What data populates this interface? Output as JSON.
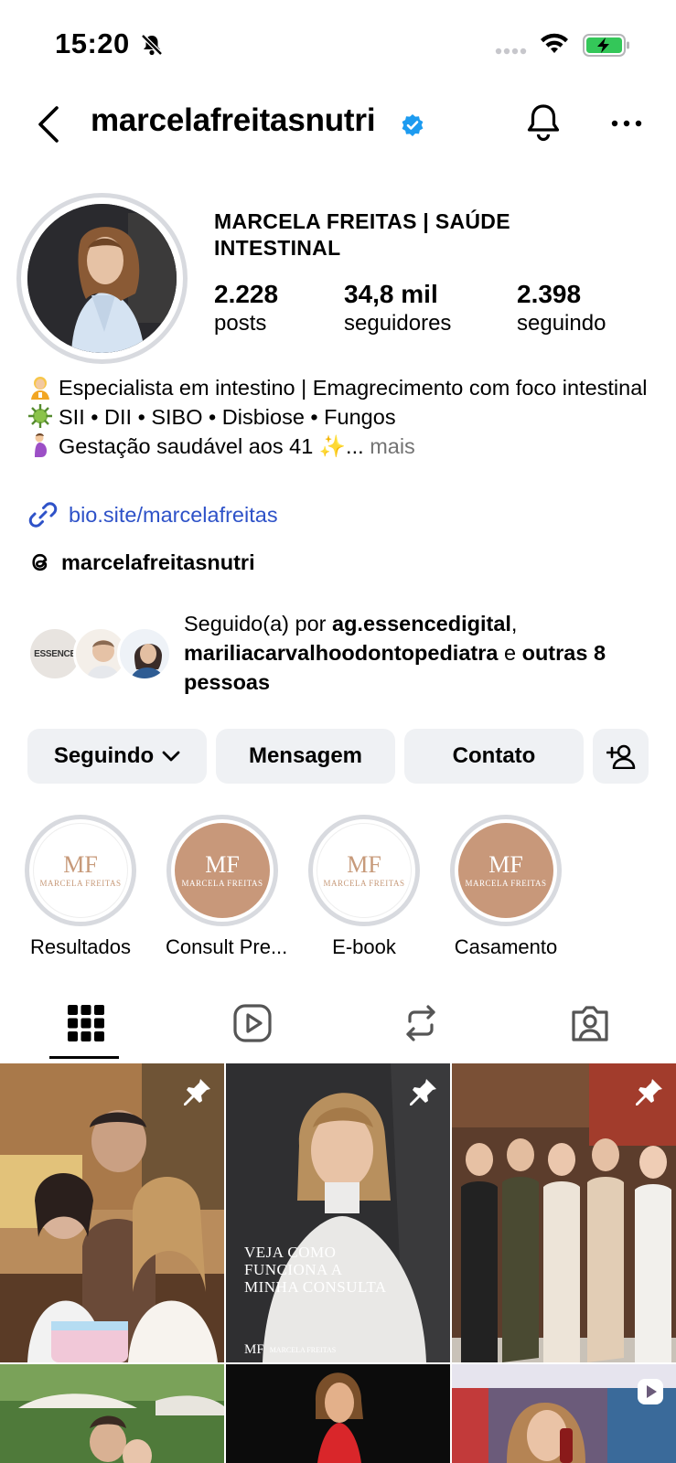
{
  "status_bar": {
    "time": "15:20",
    "icons": [
      "bell-slash-icon",
      "signal-icon",
      "wifi-icon",
      "battery-charging-icon"
    ],
    "battery_color": "#34c759"
  },
  "header": {
    "username": "marcelafreitasnutri",
    "verified": true,
    "icons": [
      "back-chevron-icon",
      "verified-badge-icon",
      "notification-bell-icon",
      "more-options-icon"
    ]
  },
  "profile": {
    "full_name": "MARCELA FREITAS | SAÚDE INTESTINAL",
    "stats": [
      {
        "value": "2.228",
        "label": "posts"
      },
      {
        "value": "34,8 mil",
        "label": "seguidores"
      },
      {
        "value": "2.398",
        "label": "seguindo"
      }
    ],
    "bio": {
      "line1": "Especialista em intestino | Emagrecimento com foco intestinal",
      "line2": "SII • DII • SIBO • Disbiose • Fungos",
      "line3": "Gestação saudável aos 41 ✨...",
      "more": "mais"
    },
    "link": "bio.site/marcelafreitas",
    "threads": "marcelafreitasnutri",
    "followed_by": {
      "prefix": "Seguido(a) por",
      "user1": "ag.essencedigital",
      "sep": ",",
      "user2": "mariliacarvalhoodontopediatra",
      "and": "e",
      "others": "outras 8 pessoas",
      "avatar_text": "ESSENCE"
    }
  },
  "actions": {
    "following": "Seguindo",
    "message": "Mensagem",
    "contact": "Contato"
  },
  "highlights": [
    {
      "label": "Resultados",
      "style": "white"
    },
    {
      "label": "Consult Pre...",
      "style": "tan"
    },
    {
      "label": "E-book",
      "style": "white"
    },
    {
      "label": "Casamento",
      "style": "tan"
    }
  ],
  "highlight_logo": {
    "mark": "MF",
    "sub": "MARCELA FREITAS"
  },
  "tabs": [
    "grid-icon",
    "reels-icon",
    "reposts-icon",
    "tagged-icon"
  ],
  "posts": [
    {
      "pinned": true
    },
    {
      "pinned": true,
      "caption_l1": "VEJA COMO",
      "caption_l2": "FUNCIONA A",
      "caption_l3": "MINHA CONSULTA",
      "footer": "MARCELA FREITAS"
    },
    {
      "pinned": true
    },
    {
      "pinned": false
    },
    {
      "pinned": false
    },
    {
      "pinned": false,
      "reel": true
    }
  ],
  "colors": {
    "link": "#2e52c8",
    "button_bg": "#eff1f4",
    "verified": "#1d9bf0",
    "highlight_tan": "#c8987a"
  }
}
